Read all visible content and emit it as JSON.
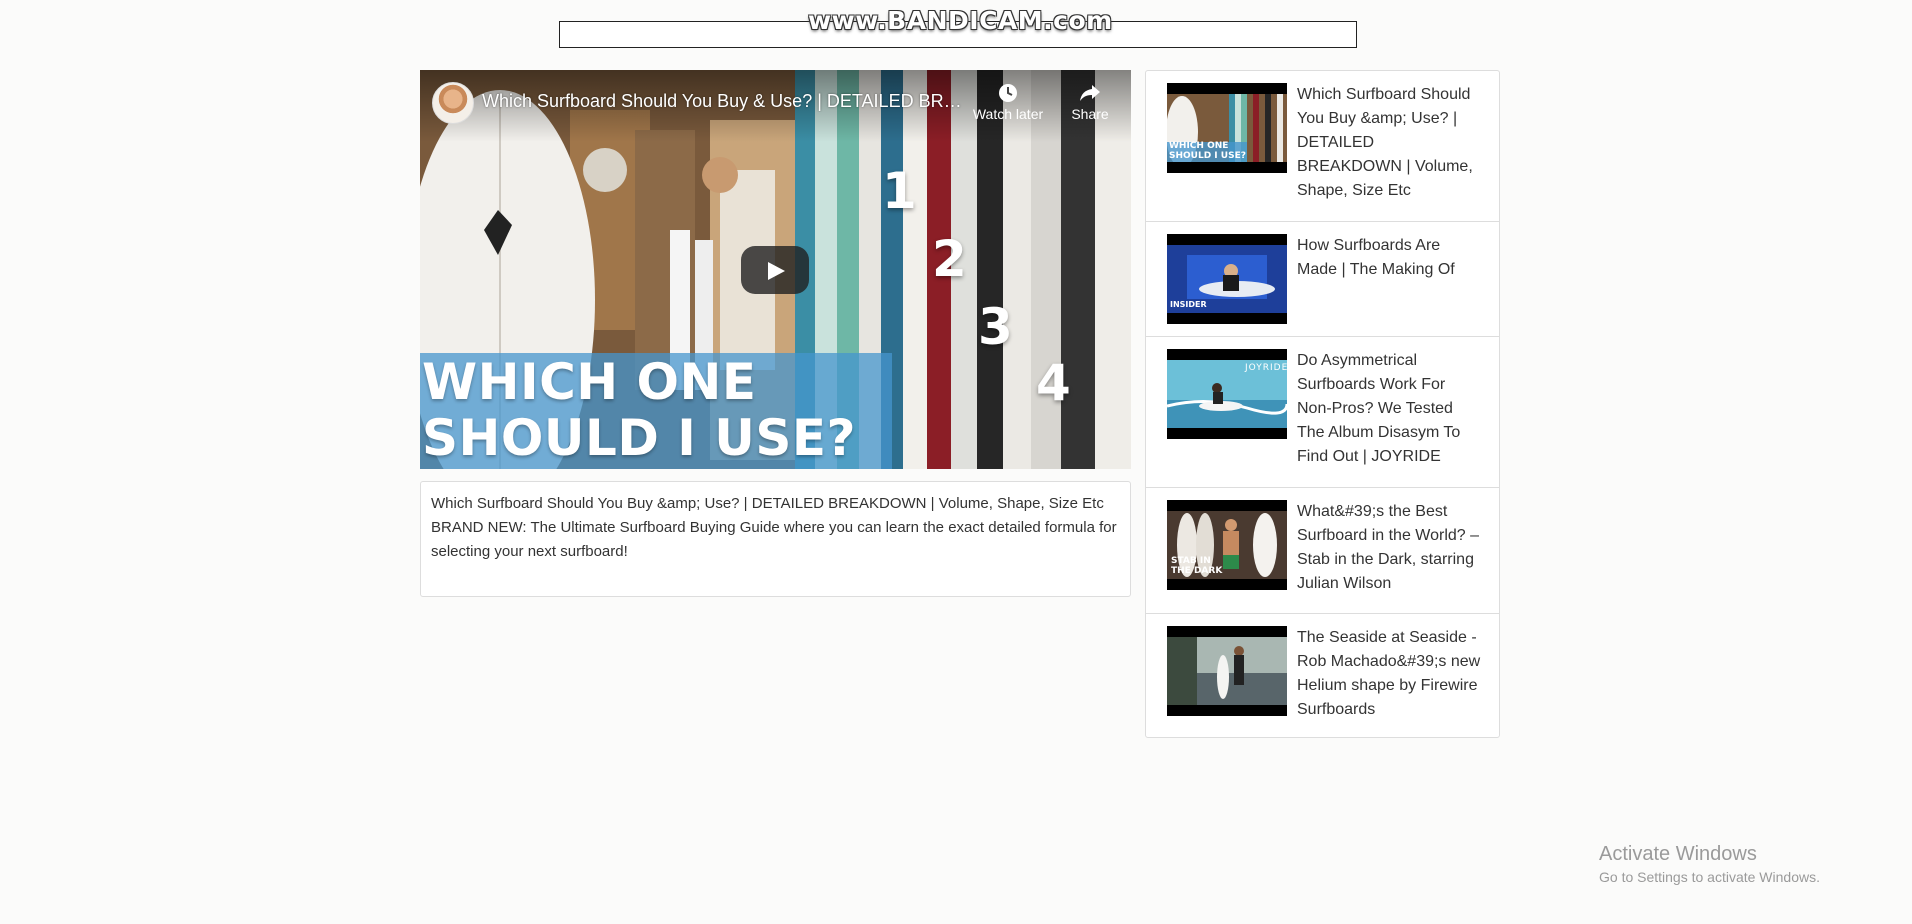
{
  "watermark": "www.BANDICAM.com",
  "search": {
    "value": "",
    "placeholder": ""
  },
  "player": {
    "title": "Which Surfboard Should You Buy & Use? | DETAILED BREAKDOWN | Volume, Shape, Size Etc",
    "watch_later": "Watch later",
    "share": "Share",
    "overlay_line1": "WHICH ONE",
    "overlay_line2": "SHOULD I USE?",
    "numbers": [
      "1",
      "2",
      "3",
      "4"
    ]
  },
  "description": {
    "title": "Which Surfboard Should You Buy &amp; Use? | DETAILED BREAKDOWN | Volume, Shape, Size Etc",
    "body": "BRAND NEW: The Ultimate Surfboard Buying Guide where you can learn the exact detailed formula for selecting your next surfboard!"
  },
  "sidebar": {
    "items": [
      {
        "title": "Which Surfboard Should You Buy &amp; Use? | DETAILED BREAKDOWN | Volume, Shape, Size Etc",
        "thumb_caption": "WHICH ONE SHOULD I USE?"
      },
      {
        "title": "How Surfboards Are Made | The Making Of",
        "thumb_caption": "INSIDER"
      },
      {
        "title": "Do Asymmetrical Surfboards Work For Non-Pros? We Tested The Album Disasym To Find Out | JOYRIDE",
        "thumb_caption": "JOYRIDE"
      },
      {
        "title": "What&#39;s the Best Surfboard in the World? – Stab in the Dark, starring Julian Wilson",
        "thumb_caption": "STAB IN THE DARK"
      },
      {
        "title": "The Seaside at Seaside - Rob Machado&#39;s new Helium shape by Firewire Surfboards",
        "thumb_caption": ""
      }
    ]
  },
  "activate_windows": {
    "title": "Activate Windows",
    "subtitle": "Go to Settings to activate Windows."
  },
  "colors": {
    "overlay_blue": "#4696cd",
    "border": "#dddddd",
    "text": "#333333"
  }
}
